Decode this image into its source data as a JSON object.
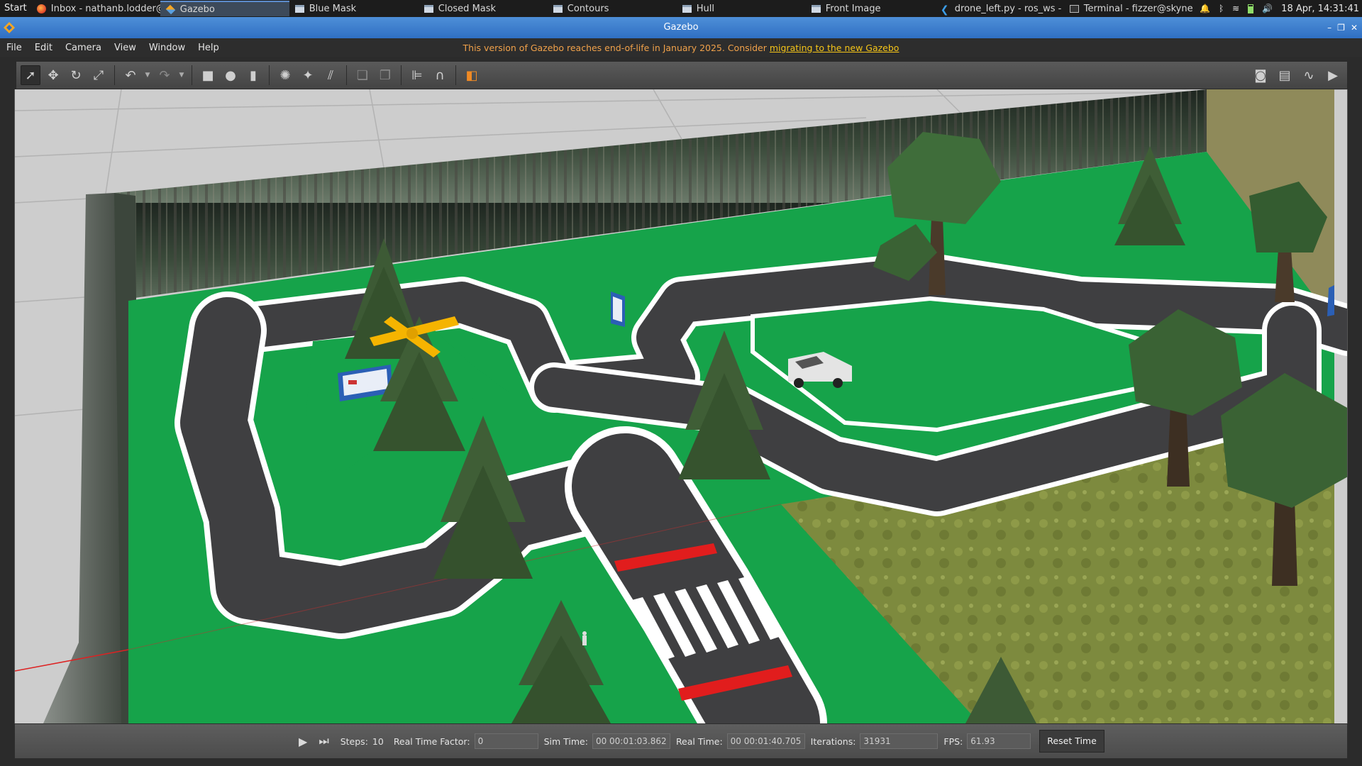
{
  "taskbar": {
    "start_label": "Start",
    "tasks": [
      {
        "label": "Inbox - nathanb.lodder@...",
        "icon": "firefox-icon"
      },
      {
        "label": "Gazebo",
        "icon": "gazebo-icon",
        "active": true
      },
      {
        "label": "Blue Mask",
        "icon": "window-icon"
      },
      {
        "label": "Closed Mask",
        "icon": "window-icon"
      },
      {
        "label": "Contours",
        "icon": "window-icon"
      },
      {
        "label": "Hull",
        "icon": "window-icon"
      },
      {
        "label": "Front Image",
        "icon": "window-icon"
      },
      {
        "label": "drone_left.py - ros_ws - Vi...",
        "icon": "vscode-icon"
      },
      {
        "label": "Terminal - fizzer@skynet:...",
        "icon": "terminal-icon"
      }
    ],
    "clock": "18 Apr, 14:31:41"
  },
  "window": {
    "title": "Gazebo"
  },
  "menu": {
    "items": [
      "File",
      "Edit",
      "Camera",
      "View",
      "Window",
      "Help"
    ]
  },
  "banner": {
    "text": "This version of Gazebo reaches end-of-life in January 2025. Consider ",
    "link": "migrating to the new Gazebo"
  },
  "toolbar": {
    "tools": [
      "select-icon",
      "translate-icon",
      "rotate-icon",
      "scale-icon",
      "undo-icon",
      "redo-icon",
      "box-icon",
      "sphere-icon",
      "cylinder-icon",
      "point-light-icon",
      "spot-light-icon",
      "directional-light-icon",
      "copy-icon",
      "paste-icon",
      "align-icon",
      "snap-icon",
      "view-angle-icon"
    ],
    "right_tools": [
      "screenshot-icon",
      "log-icon",
      "plot-icon",
      "record-icon"
    ]
  },
  "status": {
    "steps_label": "Steps:",
    "steps_value": "10",
    "rtf_label": "Real Time Factor:",
    "rtf_value": "0",
    "sim_time_label": "Sim Time:",
    "sim_time_value": "00 00:01:03.862",
    "real_time_label": "Real Time:",
    "real_time_value": "00 00:01:40.705",
    "iterations_label": "Iterations:",
    "iterations_value": "31931",
    "fps_label": "FPS:",
    "fps_value": "61.93",
    "reset_label": "Reset Time"
  },
  "colors": {
    "grass_green": "#16a34a",
    "road_gray": "#3f3f41",
    "road_line": "#ffffff",
    "stop_line": "#e11d1d",
    "drone": "#f5b400",
    "accent_blue": "#3a78c8"
  }
}
